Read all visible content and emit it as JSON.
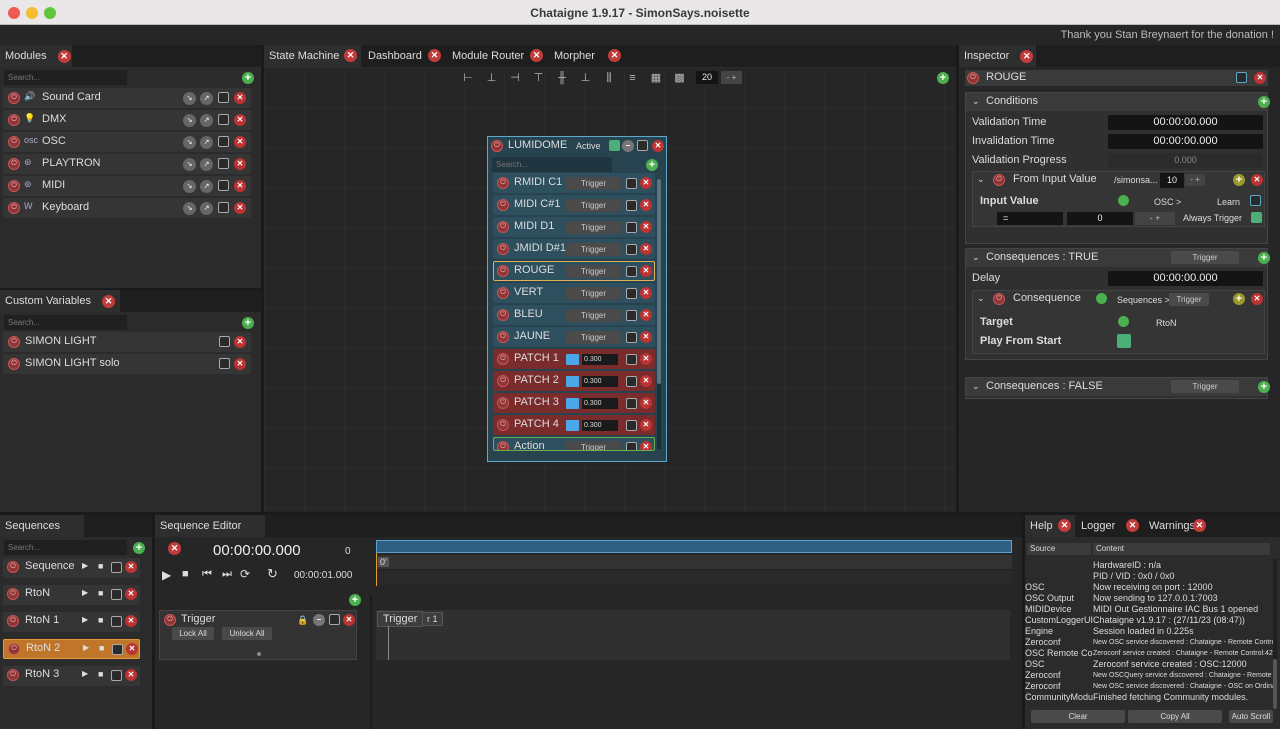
{
  "window": {
    "title": "Chataigne 1.9.17 - SimonSays.noisette",
    "banner": "Thank you Stan Breynaert for the donation !"
  },
  "modules": {
    "tab": "Modules",
    "search_placeholder": "Search...",
    "items": [
      {
        "label": "Sound Card"
      },
      {
        "label": "DMX"
      },
      {
        "label": "OSC"
      },
      {
        "label": "PLAYTRON"
      },
      {
        "label": "MIDI"
      },
      {
        "label": "Keyboard"
      }
    ]
  },
  "custom_variables": {
    "tab": "Custom Variables",
    "search_placeholder": "Search...",
    "items": [
      {
        "label": "SIMON LIGHT"
      },
      {
        "label": "SIMON LIGHT solo"
      }
    ]
  },
  "center_tabs": [
    "State Machine",
    "Dashboard",
    "Module Router",
    "Morpher"
  ],
  "toolbar": {
    "zoom_value": "20"
  },
  "state": {
    "name": "LUMIDOME",
    "status": "Active",
    "search_placeholder": "Search...",
    "items": [
      {
        "label": "RMIDI C1",
        "button": "Trigger"
      },
      {
        "label": "MIDI C#1",
        "button": "Trigger"
      },
      {
        "label": "MIDI D1",
        "button": "Trigger"
      },
      {
        "label": "JMIDI D#1",
        "button": "Trigger"
      },
      {
        "label": "ROUGE",
        "button": "Trigger"
      },
      {
        "label": "VERT",
        "button": "Trigger"
      },
      {
        "label": "BLEU",
        "button": "Trigger"
      },
      {
        "label": "JAUNE",
        "button": "Trigger"
      },
      {
        "label": "PATCH 1",
        "value": "0.300"
      },
      {
        "label": "PATCH 2",
        "value": "0.300"
      },
      {
        "label": "PATCH 3",
        "value": "0.300"
      },
      {
        "label": "PATCH 4",
        "value": "0.300"
      },
      {
        "label": "Action",
        "button": "Trigger"
      }
    ]
  },
  "inspector": {
    "tab": "Inspector",
    "item_name": "ROUGE",
    "conditions": {
      "title": "Conditions",
      "validation_time_label": "Validation Time",
      "validation_time": "00:00:00.000",
      "invalidation_time_label": "Invalidation Time",
      "invalidation_time": "00:00:00.000",
      "validation_progress_label": "Validation Progress",
      "validation_progress": "0.000",
      "from_input": {
        "title": "From Input Value",
        "path": "/simonsa...",
        "count": "10",
        "input_value_label": "Input Value",
        "osc_label": "OSC >",
        "learn_label": "Learn",
        "operator": "=",
        "compare_value": "0",
        "always_trigger_label": "Always Trigger"
      }
    },
    "consequences_true": {
      "title": "Consequences : TRUE",
      "trigger": "Trigger",
      "delay_label": "Delay",
      "delay": "00:00:00.000",
      "consequence": {
        "title": "Consequence",
        "target_path": "Sequences >...",
        "trigger": "Trigger",
        "target_label": "Target",
        "target_value": "RtoN",
        "play_from_start_label": "Play From Start"
      }
    },
    "consequences_false": {
      "title": "Consequences : FALSE",
      "trigger": "Trigger"
    }
  },
  "sequences": {
    "tab": "Sequences",
    "search_placeholder": "Search...",
    "items": [
      {
        "label": "Sequence"
      },
      {
        "label": "RtoN"
      },
      {
        "label": "RtoN 1"
      },
      {
        "label": "RtoN 2"
      },
      {
        "label": "RtoN 3"
      }
    ]
  },
  "sequence_editor": {
    "tab": "Sequence Editor",
    "current_time": "00:00:00.000",
    "frame": "0",
    "total_time": "00:00:01.000",
    "cursor_label": "0'",
    "layer": {
      "name": "Trigger",
      "lock_all": "Lock All",
      "unlock_all": "Unlock All"
    },
    "trigger_label": "Trigger",
    "trigger_suffix": "r 1"
  },
  "log": {
    "tabs": [
      "Help",
      "Logger",
      "Warnings"
    ],
    "col_source": "Source",
    "col_content": "Content",
    "rows": [
      {
        "source": "",
        "content": "HardwareID : n/a"
      },
      {
        "source": "",
        "content": "PID / VID : 0x0 / 0x0"
      },
      {
        "source": "OSC",
        "content": "Now receiving on port : 12000"
      },
      {
        "source": "OSC Output",
        "content": "Now sending to 127.0.0.1:7003"
      },
      {
        "source": "MIDIDevice",
        "content": "MIDI Out Gestionnaire IAC Bus 1 opened"
      },
      {
        "source": "CustomLoggerUI",
        "content": "Chataigne v1.9.17 : (27/11/23 (08:47))"
      },
      {
        "source": "Engine",
        "content": "Session loaded in 0.225s"
      },
      {
        "source": "Zeroconf",
        "content": "New OSC service discovered : Chataigne - Remote Contro..."
      },
      {
        "source": "OSC Remote Control",
        "content": "Zeroconf service created : Chataigne - Remote Control:42..."
      },
      {
        "source": "OSC",
        "content": "Zeroconf service created : OSC:12000"
      },
      {
        "source": "Zeroconf",
        "content": "New OSCQuery service discovered : Chataigne - Remote C..."
      },
      {
        "source": "Zeroconf",
        "content": "New OSC service discovered : Chataigne - OSC on Ordinat..."
      },
      {
        "source": "CommunityModule...",
        "content": "Finished fetching Community modules."
      }
    ],
    "clear": "Clear",
    "copy_all": "Copy All",
    "auto_scroll": "Auto Scroll"
  }
}
